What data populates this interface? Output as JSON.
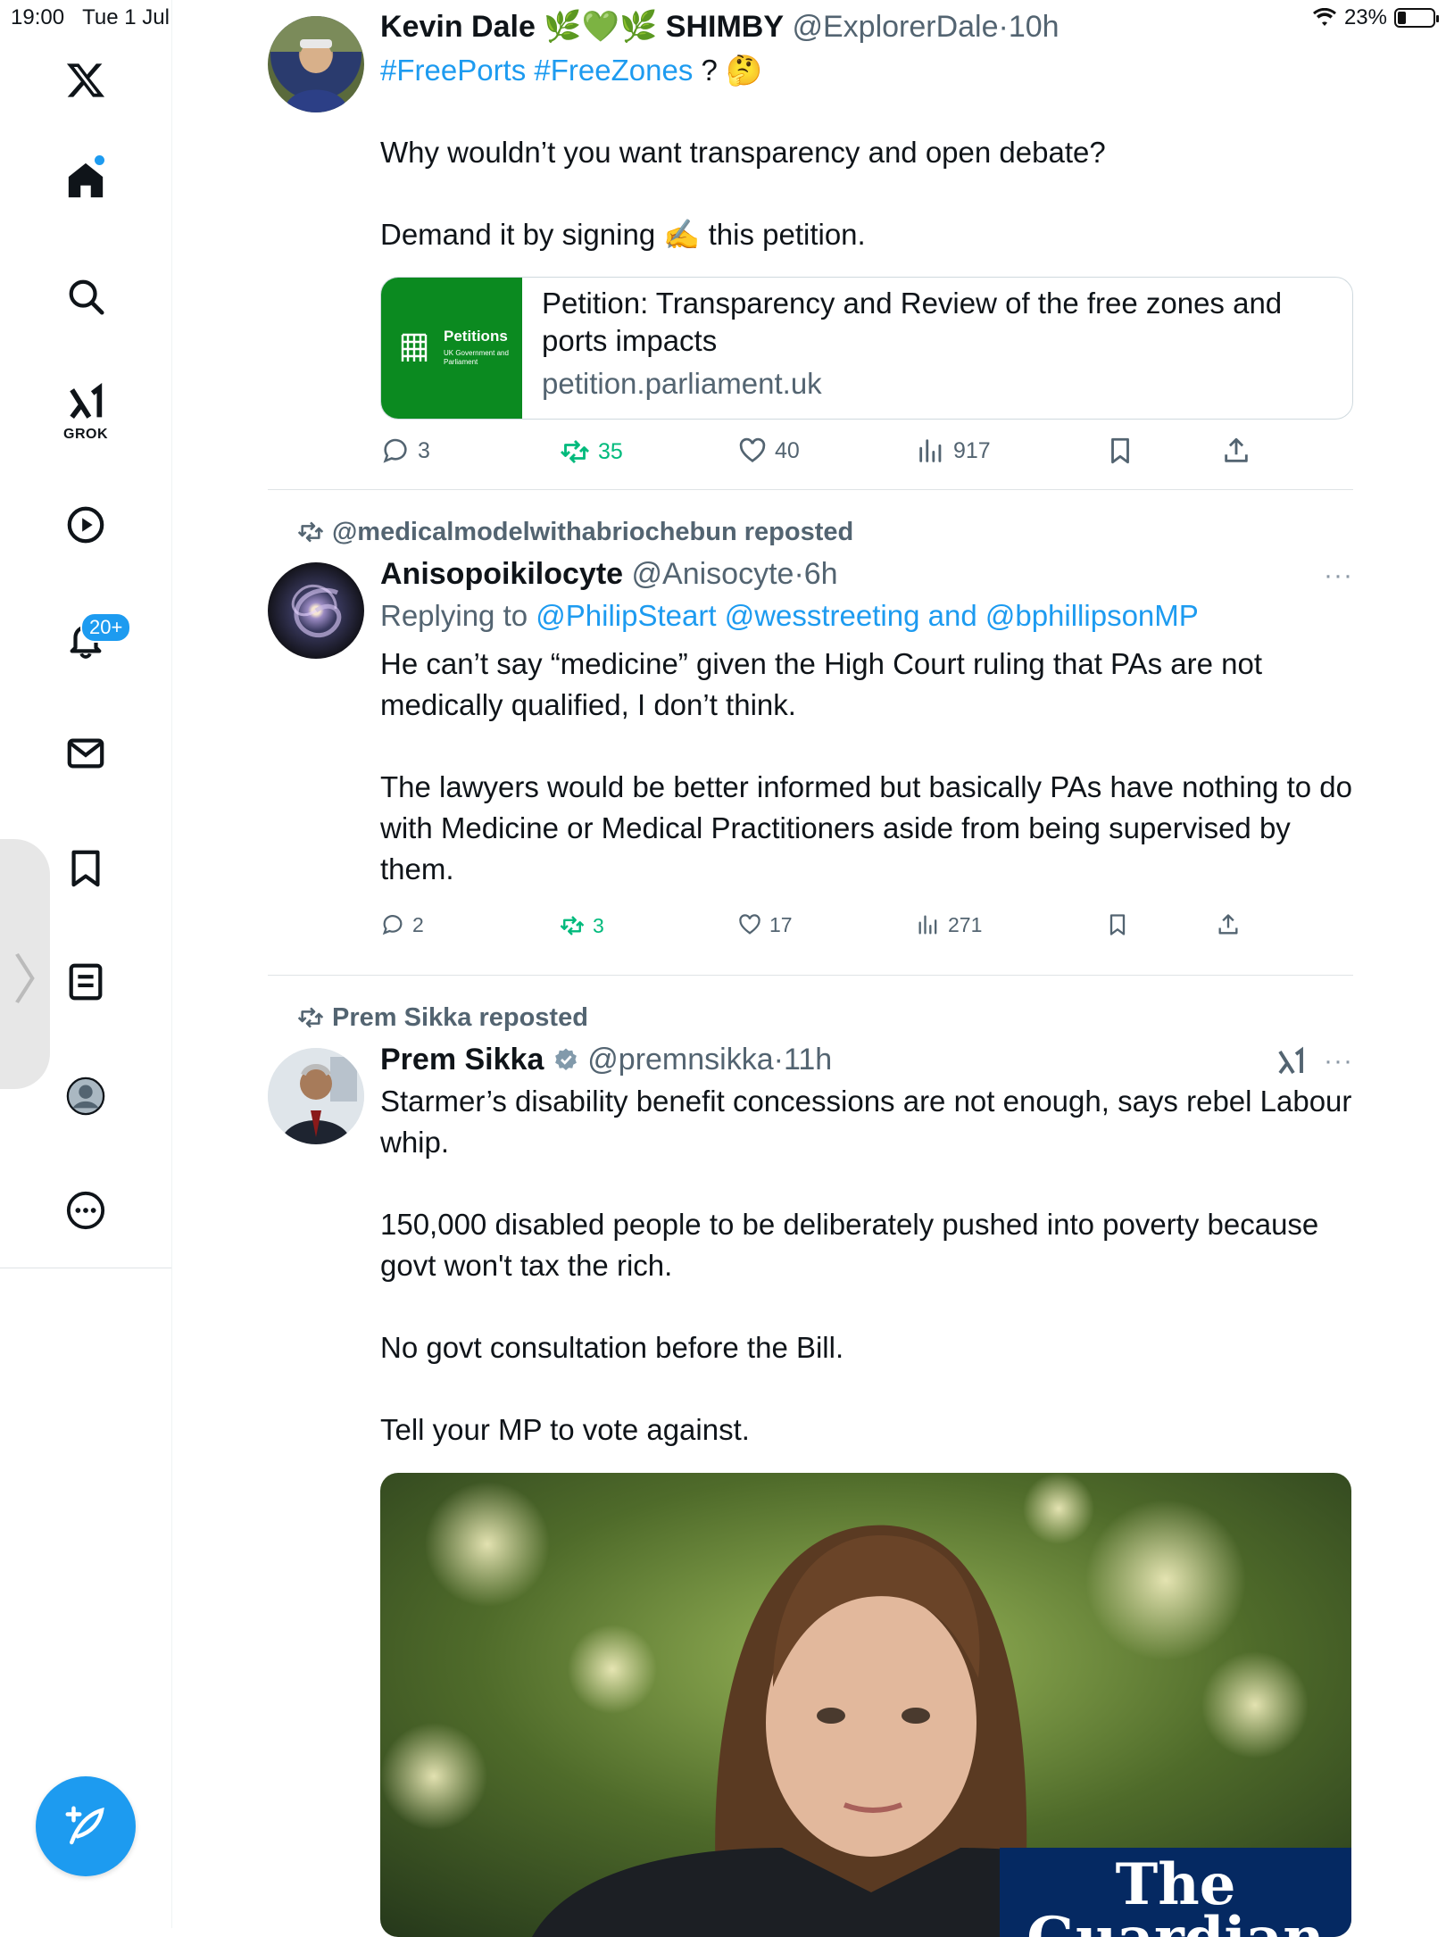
{
  "status": {
    "time": "19:00",
    "date": "Tue 1 Jul",
    "battery": "23%",
    "battery_level": 0.23
  },
  "sidebar": {
    "grok_label": "GROK",
    "notification_badge": "20+"
  },
  "tweet1": {
    "name": "Kevin Dale",
    "name_emoji": "🌿💚🌿",
    "name_suffix": "SHIMBY",
    "handle": "@ExplorerDale",
    "time": "10h",
    "hashtags": "#FreePorts #FreeZones",
    "hashtag_tail": " ? 🤔",
    "para1": "Why wouldn’t you want transparency and open debate?",
    "para2": "Demand it by signing ✍️ this petition.",
    "card": {
      "thumb_title": "Petitions",
      "thumb_sub": "UK Government and Parliament",
      "title": "Petition: Transparency and Review of the free zones and ports impacts",
      "domain": "petition.parliament.uk"
    },
    "replies": "3",
    "reposts": "35",
    "likes": "40",
    "views": "917"
  },
  "tweet2": {
    "repost_by": "@medicalmodelwithabriochebun reposted",
    "name": "Anisopoikilocyte",
    "handle": "@Anisocyte",
    "time": "6h",
    "replying_prefix": "Replying to ",
    "replying_to": "@PhilipSteart @wesstreeting and @bphillipsonMP",
    "para1": "He can’t say “medicine” given the High Court ruling that PAs are not medically qualified, I don’t think.",
    "para2": "The lawyers would be better informed but basically PAs have nothing to do with Medicine or Medical Practitioners aside from being supervised by them.",
    "replies": "2",
    "reposts": "3",
    "likes": "17",
    "views": "271"
  },
  "tweet3": {
    "repost_by": "Prem Sikka reposted",
    "name": "Prem Sikka",
    "handle": "@premnsikka",
    "time": "11h",
    "para1": "Starmer’s disability benefit concessions are not enough, says rebel Labour whip.",
    "para2": "150,000 disabled people to be deliberately pushed into poverty because govt won't tax the rich.",
    "para3": "No govt consultation before the Bill.",
    "para4": "Tell your MP to vote against.",
    "image_brand": "The Guardian"
  },
  "colors": {
    "accent": "#1d9bf0",
    "repost_green": "#00ba7c",
    "muted": "#536471",
    "petition_green": "#0b8a20",
    "guardian_blue": "#052962"
  }
}
